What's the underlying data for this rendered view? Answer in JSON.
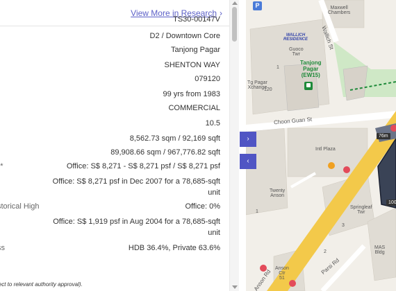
{
  "panel": {
    "view_more_label": "View More in Research",
    "view_more_chevron": "›",
    "rows": [
      {
        "key": "",
        "value": "TS30-00147V"
      },
      {
        "key": "",
        "value": "D2 / Downtown Core"
      },
      {
        "key": "",
        "value": "Tanjong Pagar"
      },
      {
        "key": "",
        "value": "SHENTON WAY"
      },
      {
        "key": "",
        "value": "079120"
      },
      {
        "key": "",
        "value": "99 yrs from 1983"
      },
      {
        "key": "",
        "value": "COMMERCIAL"
      },
      {
        "key": "",
        "value": "10.5"
      },
      {
        "key": "",
        "value": "8,562.73 sqm / 92,169 sqft"
      },
      {
        "key": "",
        "value": "89,908.66 sqm / 967,776.82 sqft"
      },
      {
        "key": "**",
        "value": "Office: S$ 8,271 - S$ 8,271 psf / S$ 8,271 psf"
      },
      {
        "key": "",
        "value": "Office: S$ 8,271 psf in Dec 2007 for a 78,685-sqft unit"
      },
      {
        "key": "storical High",
        "value": "Office: 0%"
      },
      {
        "key": "",
        "value": "Office: S$ 1,919 psf in Aug 2004 for a 78,685-sqft unit"
      },
      {
        "key": "ss",
        "value": "HDB 36.4%, Private 63.6%"
      }
    ],
    "footnote": "ject to relevant authority approval)."
  },
  "map": {
    "labels": {
      "maxwell": "Maxwell\nChambers",
      "wallich_residence": "WALLICH\nRESIDENCE",
      "guoco": "Guoco\nTwr",
      "tanjong_pagar_mrt": "Tanjong\nPagar\n(EW15)",
      "tg_pagar_xchange": "Tg Pagar\nXchange",
      "num_120": "120",
      "num_1a": "1",
      "choon_guan": "Choon Guan St",
      "wallich_st": "Wallich St",
      "intl_plaza": "Intl Plaza",
      "twenty_anson": "Twenty\nAnson",
      "springleaf": "Springleaf\nTwr",
      "num_3": "3",
      "mas": "MAS\nBldg",
      "anson_ctr": "Anson\nCtr\n51",
      "anson_rd": "Anson Rd",
      "parsi_rd": "Parsi Rd",
      "num_2": "2",
      "num_1b": "1"
    },
    "badge_76m": "76m",
    "badge_100": "100",
    "parking_icon": "P"
  },
  "toggles": {
    "expand": "›",
    "collapse": "‹"
  },
  "colors": {
    "accent": "#5055c4",
    "link": "#5b5fc7",
    "mrt_green": "#1f8a3a",
    "road_yellow": "#f3c94a"
  }
}
